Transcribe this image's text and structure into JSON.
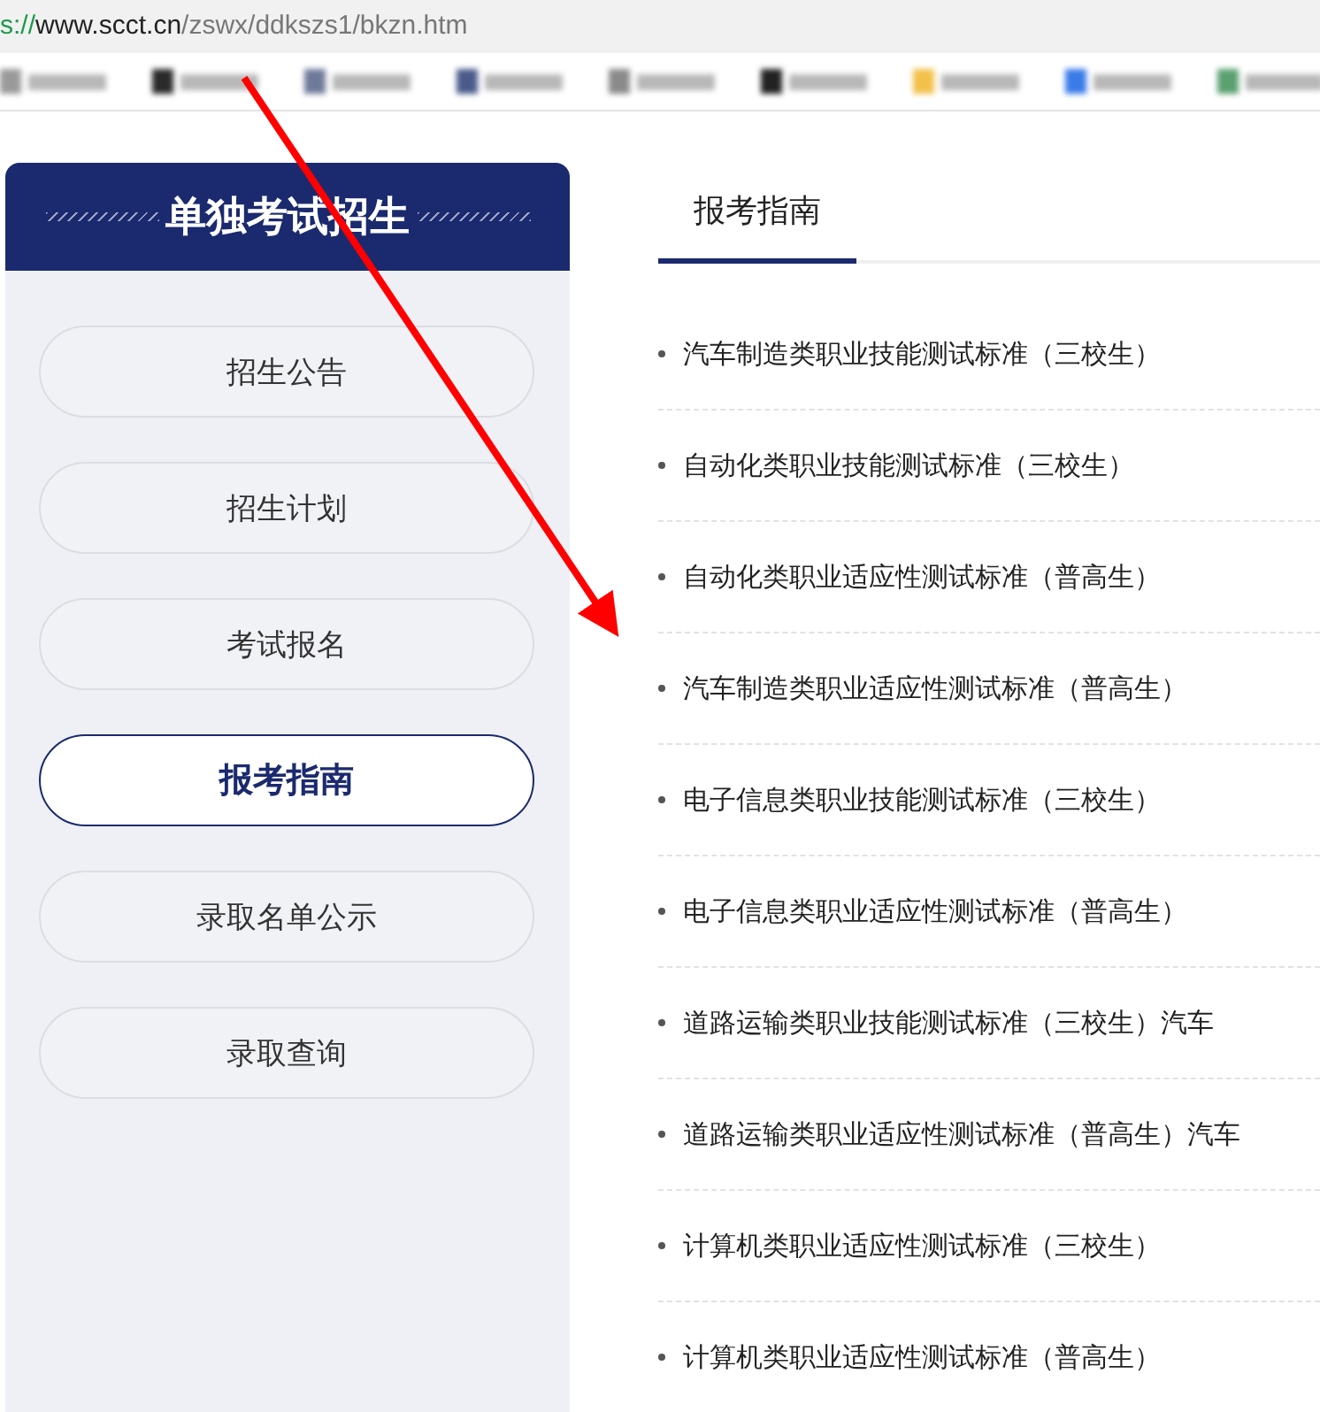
{
  "address_bar": {
    "scheme": "s://",
    "host": "www.scct.cn",
    "path": "/zswx/ddkszs1/bkzn.htm"
  },
  "bookmarks_bar": [
    {
      "kind": "blurred",
      "color": "#9a9a9a"
    },
    {
      "kind": "blurred",
      "color": "#2a2a2a"
    },
    {
      "kind": "blurred",
      "color": "#6f7a9a"
    },
    {
      "kind": "blurred",
      "color": "#4a5a8a"
    },
    {
      "kind": "blurred",
      "color": "#8a8a8a"
    },
    {
      "kind": "blurred",
      "color": "#222222"
    },
    {
      "kind": "blurred",
      "color": "#f3c14a"
    },
    {
      "kind": "blurred",
      "color": "#3a7be8"
    },
    {
      "kind": "blurred",
      "color": "#5aa070"
    }
  ],
  "sidebar": {
    "title": "单独考试招生",
    "items": [
      {
        "label": "招生公告",
        "selected": false
      },
      {
        "label": "招生计划",
        "selected": false
      },
      {
        "label": "考试报名",
        "selected": false
      },
      {
        "label": "报考指南",
        "selected": true
      },
      {
        "label": "录取名单公示",
        "selected": false
      },
      {
        "label": "录取查询",
        "selected": false
      }
    ]
  },
  "content": {
    "tab": "报考指南",
    "items": [
      "汽车制造类职业技能测试标准（三校生）",
      "自动化类职业技能测试标准（三校生）",
      "自动化类职业适应性测试标准（普高生）",
      "汽车制造类职业适应性测试标准（普高生）",
      "电子信息类职业技能测试标准（三校生）",
      "电子信息类职业适应性测试标准（普高生）",
      "道路运输类职业技能测试标准（三校生）汽车",
      "道路运输类职业适应性测试标准（普高生）汽车",
      "计算机类职业适应性测试标准（三校生）",
      "计算机类职业适应性测试标准（普高生）"
    ]
  },
  "annotation": {
    "kind": "arrow",
    "color": "#ff0000"
  }
}
